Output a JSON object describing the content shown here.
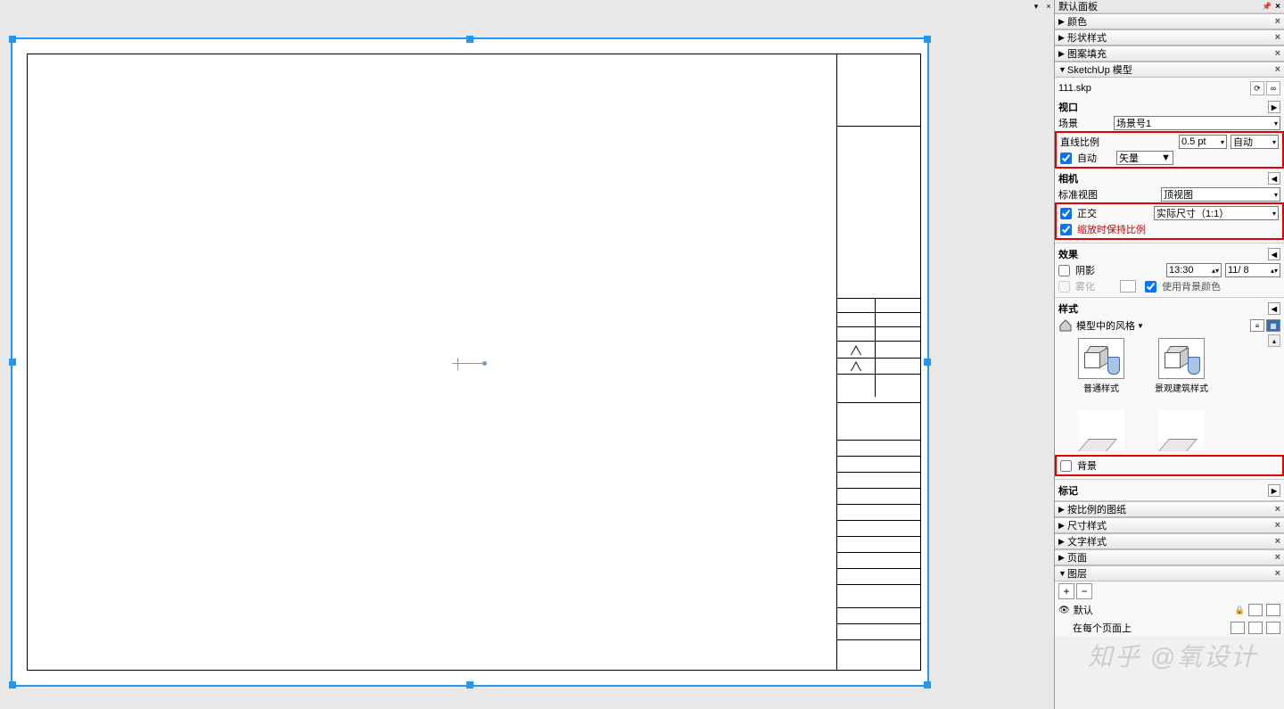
{
  "top_bar": {
    "dropdown": "▾",
    "close": "×"
  },
  "panel_title": "默认面板",
  "sections": {
    "color": "颜色",
    "shape_style": "形状样式",
    "pattern_fill": "图案填充",
    "sketchup_model": "SketchUp 模型",
    "scaled_drawing": "按比例的图纸",
    "dim_style": "尺寸样式",
    "text_style": "文字样式",
    "page": "页面",
    "layers": "图层"
  },
  "file_name": "111.skp",
  "viewport": {
    "header": "视口",
    "scene_lbl": "场景",
    "scene_val": "场景号1",
    "line_scale_lbl": "直线比例",
    "line_scale_val": "0.5 pt",
    "line_scale_mode": "自动",
    "auto_lbl": "自动",
    "render_val": "矢量"
  },
  "camera": {
    "header": "相机",
    "std_view_lbl": "标准视图",
    "std_view_val": "顶视图",
    "ortho_lbl": "正交",
    "scale_val": "实际尺寸（1:1）",
    "keep_scale_lbl": "缩放时保持比例"
  },
  "effect": {
    "header": "效果",
    "shadow_lbl": "阴影",
    "time_val": "13:30",
    "date_val": "11/ 8",
    "fog_lbl": "雾化",
    "use_bg_lbl": "使用背景颜色"
  },
  "style": {
    "header": "样式",
    "dropdown": "模型中的风格",
    "item1": "普通样式",
    "item2": "景观建筑样式",
    "bg_lbl": "背景"
  },
  "tags": {
    "header": "标记"
  },
  "layers": {
    "default_lbl": "默认",
    "pages_lbl": "在每个页面上"
  },
  "watermark": "知乎 @氧设计"
}
